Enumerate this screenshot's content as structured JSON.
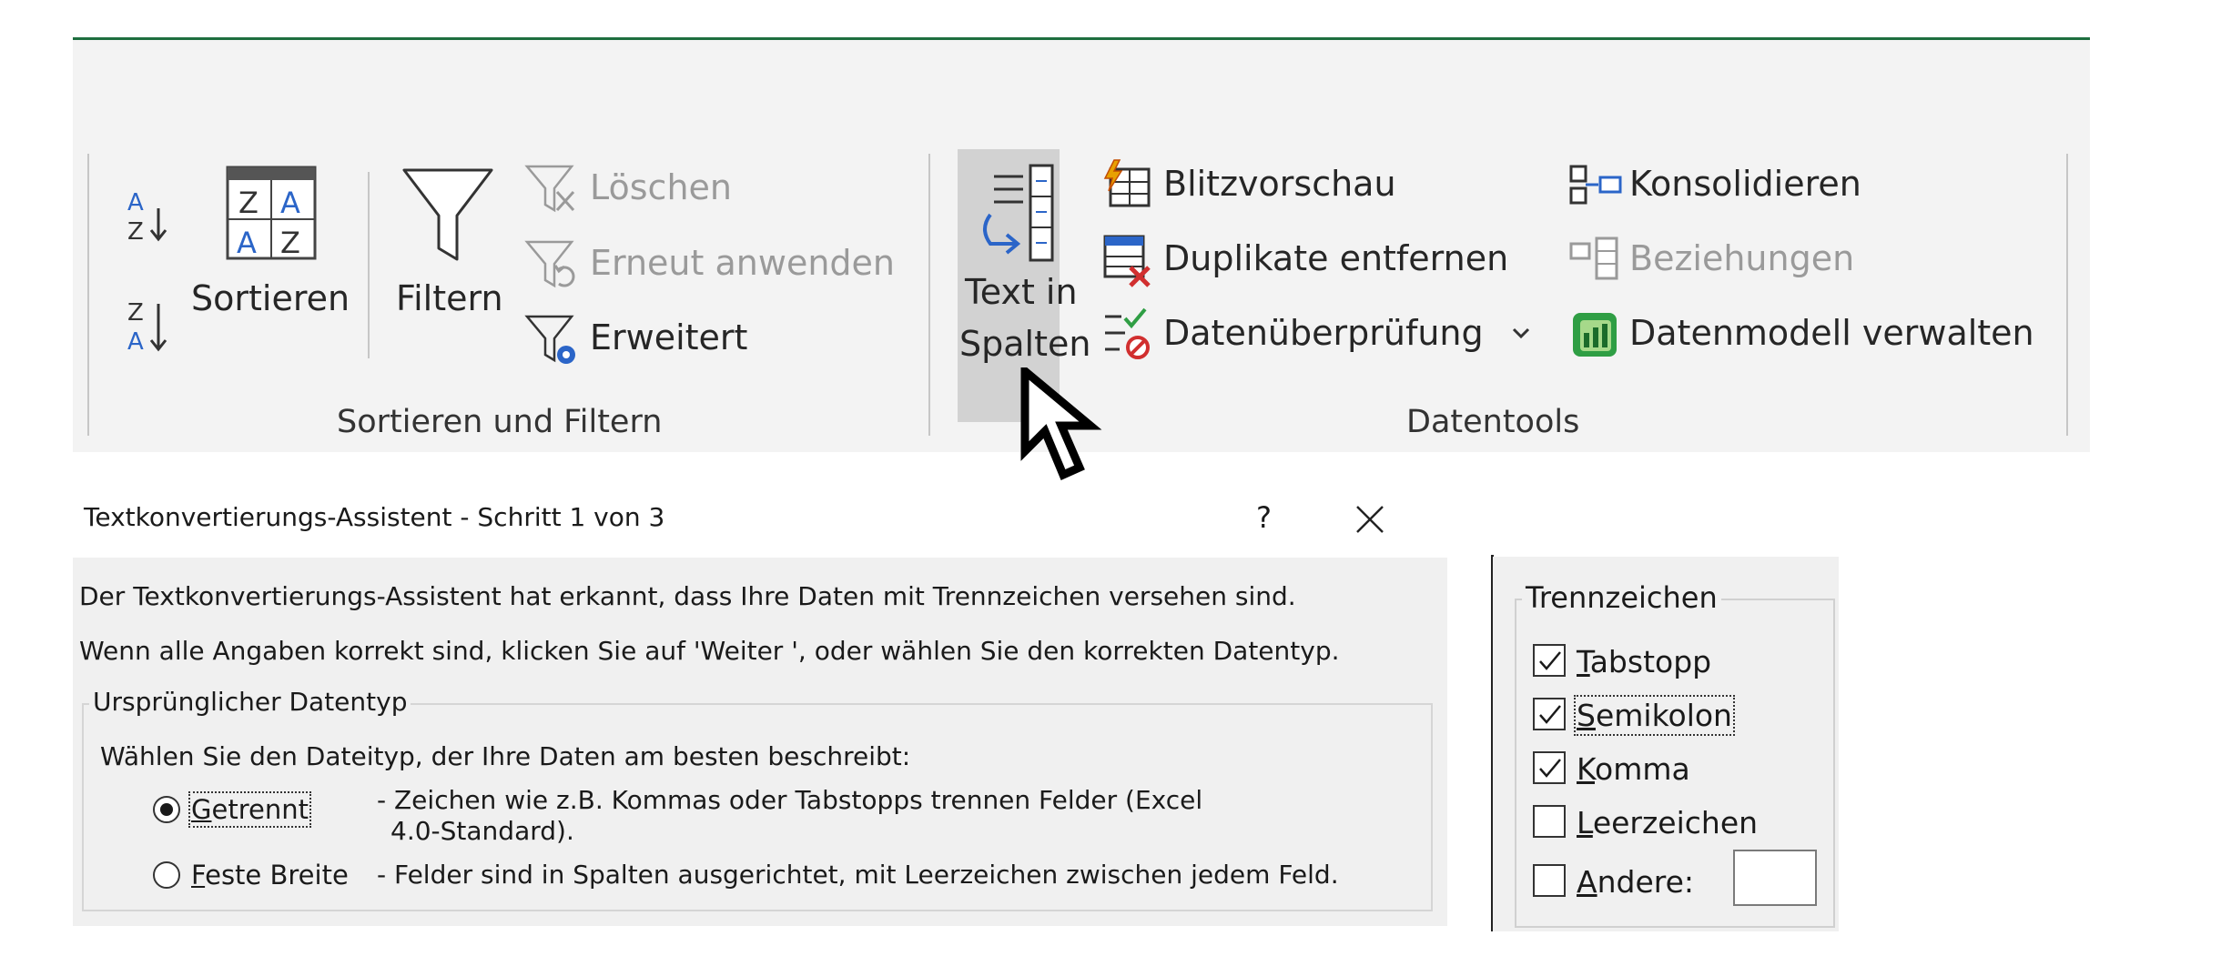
{
  "ribbon": {
    "sort_group": {
      "label": "Sortieren und Filtern",
      "sort_az_icon": "sort-a-z-icon",
      "sort_za_icon": "sort-z-a-icon",
      "sort_button": "Sortieren",
      "filter_button": "Filtern",
      "clear_button": "Löschen",
      "reapply_button": "Erneut anwenden",
      "advanced_button": "Erweitert"
    },
    "data_tools_group": {
      "label": "Datentools",
      "text_to_columns_line1": "Text in",
      "text_to_columns_line2": "Spalten",
      "flash_fill": "Blitzvorschau",
      "remove_duplicates": "Duplikate entfernen",
      "data_validation": "Datenüberprüfung",
      "consolidate": "Konsolidieren",
      "relationships": "Beziehungen",
      "manage_data_model": "Datenmodell verwalten"
    },
    "accent_color": "#1e6e3f"
  },
  "dialog": {
    "title": "Textkonvertierungs-Assistent - Schritt 1 von 3",
    "help_button": "?",
    "line1": "Der Textkonvertierungs-Assistent hat erkannt, dass Ihre Daten mit Trennzeichen versehen sind.",
    "line2": "Wenn alle Angaben korrekt sind, klicken Sie auf 'Weiter ', oder wählen Sie den korrekten Datentyp.",
    "group_title": "Ursprünglicher Datentyp",
    "group_prompt": "Wählen Sie den Dateityp, der Ihre Daten am besten beschreibt:",
    "options": [
      {
        "label": "Getrennt",
        "accel": "G",
        "rest": "etrennt",
        "desc_line1": "- Zeichen wie z.B. Kommas oder Tabstopps trennen Felder (Excel",
        "desc_line2": "4.0-Standard).",
        "selected": true
      },
      {
        "label": "Feste Breite",
        "accel": "F",
        "rest": "este Breite",
        "desc_line1": "- Felder sind in Spalten ausgerichtet, mit Leerzeichen zwischen jedem Feld.",
        "selected": false
      }
    ]
  },
  "delimiters": {
    "title": "Trennzeichen",
    "items": [
      {
        "accel": "T",
        "rest": "abstopp",
        "checked": true
      },
      {
        "accel": "S",
        "rest": "emikolon",
        "checked": true
      },
      {
        "accel": "K",
        "rest": "omma",
        "checked": true
      },
      {
        "accel": "L",
        "rest": "eerzeichen",
        "checked": false
      },
      {
        "accel": "A",
        "rest": "ndere:",
        "checked": false
      }
    ],
    "other_value": ""
  }
}
